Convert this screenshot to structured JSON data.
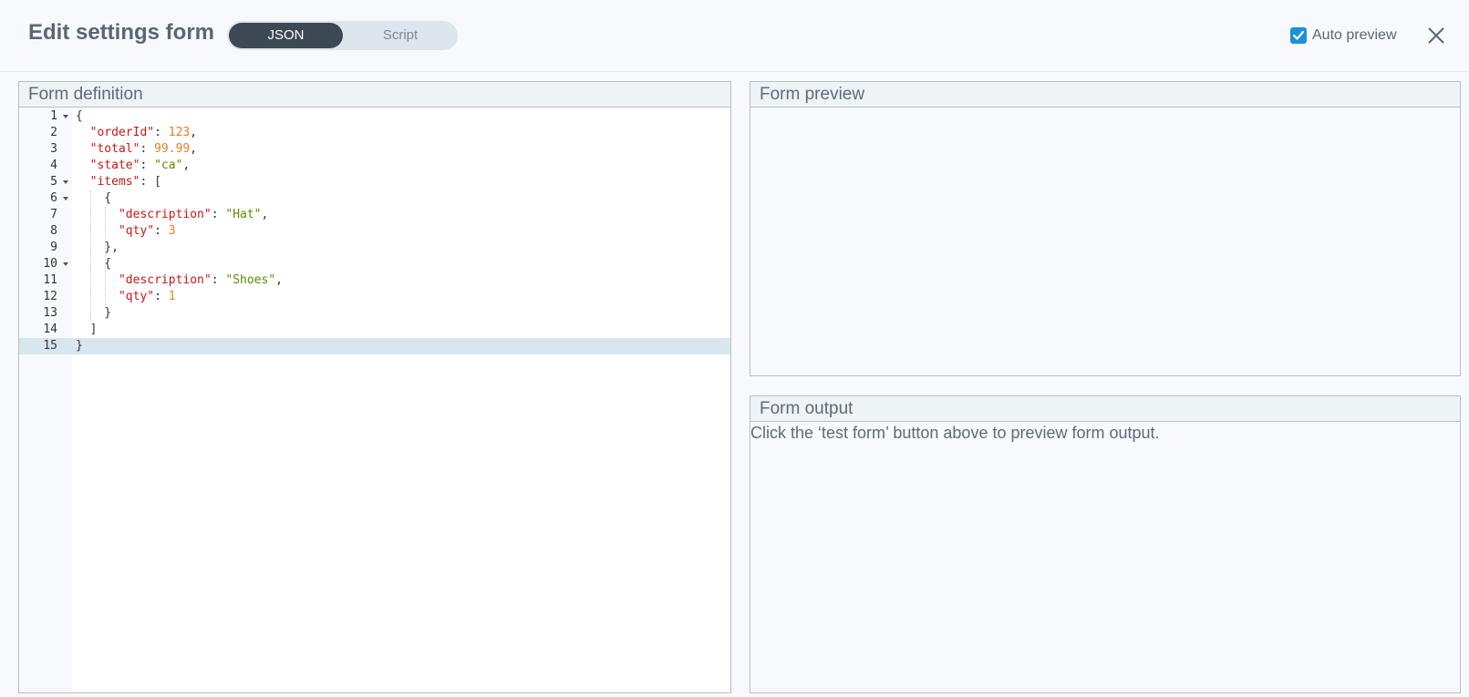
{
  "header": {
    "title": "Edit settings form",
    "tabs": [
      {
        "label": "JSON",
        "active": true
      },
      {
        "label": "Script",
        "active": false
      }
    ],
    "auto_preview": {
      "label": "Auto preview",
      "checked": true
    },
    "close_icon": "close-icon"
  },
  "form_definition": {
    "title": "Form definition",
    "lines": [
      {
        "n": "1",
        "fold": true,
        "tokens": [
          {
            "t": "p",
            "v": "{"
          }
        ]
      },
      {
        "n": "2",
        "fold": false,
        "tokens": [
          {
            "t": "p",
            "v": "  "
          },
          {
            "t": "k",
            "v": "\"orderId\""
          },
          {
            "t": "p",
            "v": ": "
          },
          {
            "t": "n",
            "v": "123"
          },
          {
            "t": "p",
            "v": ","
          }
        ]
      },
      {
        "n": "3",
        "fold": false,
        "tokens": [
          {
            "t": "p",
            "v": "  "
          },
          {
            "t": "k",
            "v": "\"total\""
          },
          {
            "t": "p",
            "v": ": "
          },
          {
            "t": "n",
            "v": "99.99"
          },
          {
            "t": "p",
            "v": ","
          }
        ]
      },
      {
        "n": "4",
        "fold": false,
        "tokens": [
          {
            "t": "p",
            "v": "  "
          },
          {
            "t": "k",
            "v": "\"state\""
          },
          {
            "t": "p",
            "v": ": "
          },
          {
            "t": "s",
            "v": "\"ca\""
          },
          {
            "t": "p",
            "v": ","
          }
        ]
      },
      {
        "n": "5",
        "fold": true,
        "tokens": [
          {
            "t": "p",
            "v": "  "
          },
          {
            "t": "k",
            "v": "\"items\""
          },
          {
            "t": "p",
            "v": ": ["
          }
        ]
      },
      {
        "n": "6",
        "fold": true,
        "tokens": [
          {
            "t": "p",
            "v": "    {"
          }
        ]
      },
      {
        "n": "7",
        "fold": false,
        "tokens": [
          {
            "t": "p",
            "v": "      "
          },
          {
            "t": "k",
            "v": "\"description\""
          },
          {
            "t": "p",
            "v": ": "
          },
          {
            "t": "s",
            "v": "\"Hat\""
          },
          {
            "t": "p",
            "v": ","
          }
        ]
      },
      {
        "n": "8",
        "fold": false,
        "tokens": [
          {
            "t": "p",
            "v": "      "
          },
          {
            "t": "k",
            "v": "\"qty\""
          },
          {
            "t": "p",
            "v": ": "
          },
          {
            "t": "n",
            "v": "3"
          }
        ]
      },
      {
        "n": "9",
        "fold": false,
        "tokens": [
          {
            "t": "p",
            "v": "    },"
          }
        ]
      },
      {
        "n": "10",
        "fold": true,
        "tokens": [
          {
            "t": "p",
            "v": "    {"
          }
        ]
      },
      {
        "n": "11",
        "fold": false,
        "tokens": [
          {
            "t": "p",
            "v": "      "
          },
          {
            "t": "k",
            "v": "\"description\""
          },
          {
            "t": "p",
            "v": ": "
          },
          {
            "t": "s",
            "v": "\"Shoes\""
          },
          {
            "t": "p",
            "v": ","
          }
        ]
      },
      {
        "n": "12",
        "fold": false,
        "tokens": [
          {
            "t": "p",
            "v": "      "
          },
          {
            "t": "k",
            "v": "\"qty\""
          },
          {
            "t": "p",
            "v": ": "
          },
          {
            "t": "n",
            "v": "1"
          }
        ]
      },
      {
        "n": "13",
        "fold": false,
        "tokens": [
          {
            "t": "p",
            "v": "    }"
          }
        ]
      },
      {
        "n": "14",
        "fold": false,
        "tokens": [
          {
            "t": "p",
            "v": "  ]"
          }
        ]
      },
      {
        "n": "15",
        "fold": false,
        "active": true,
        "tokens": [
          {
            "t": "p",
            "v": "}"
          }
        ]
      }
    ]
  },
  "form_preview": {
    "title": "Form preview"
  },
  "form_output": {
    "title": "Form output",
    "message": "Click the ‘test form’ button above to preview form output."
  },
  "colors": {
    "accent": "#1a92d6",
    "toggle_active": "#3d4855",
    "json_key": "#c41a16",
    "json_number": "#e67e22",
    "json_string": "#5c8a00"
  }
}
